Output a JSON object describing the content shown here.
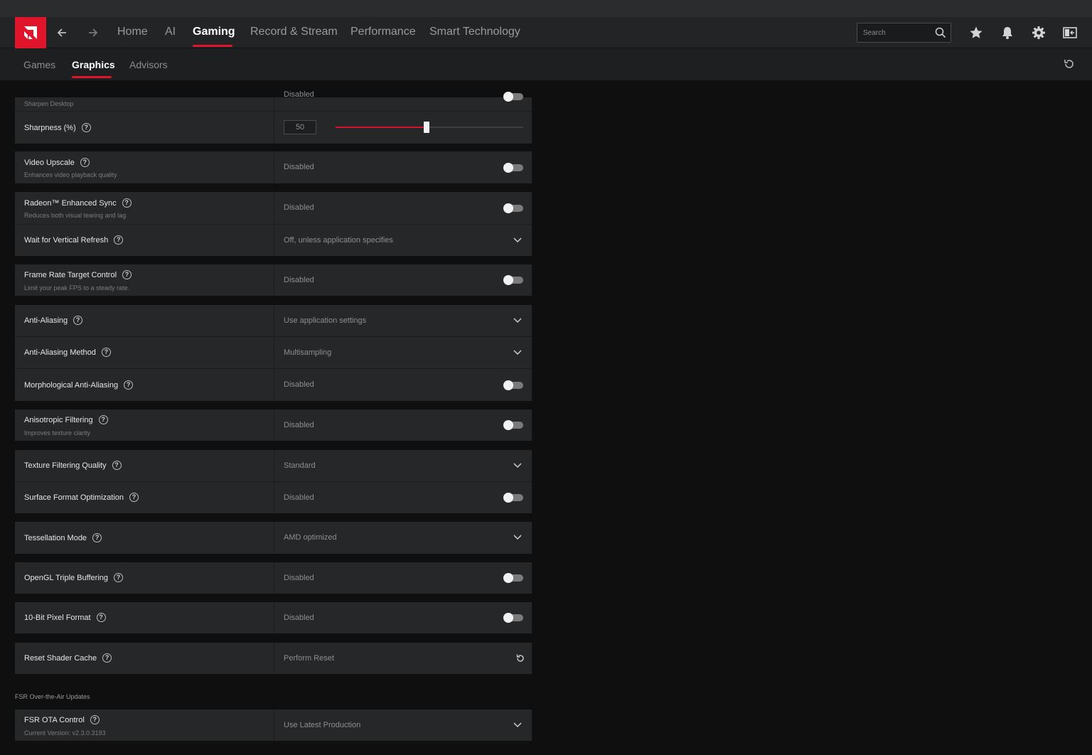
{
  "nav": {
    "tabs": [
      {
        "label": "Home"
      },
      {
        "label": "AI"
      },
      {
        "label": "Gaming"
      },
      {
        "label": "Record & Stream"
      },
      {
        "label": "Performance"
      },
      {
        "label": "Smart Technology"
      }
    ],
    "active_tab": "Gaming",
    "search_placeholder": "Search",
    "icons": [
      "back-arrow-icon",
      "forward-arrow-icon",
      "search-icon",
      "star-icon",
      "bell-icon",
      "gear-icon",
      "sidebar-panel-icon"
    ]
  },
  "subnav": {
    "tabs": [
      {
        "label": "Games"
      },
      {
        "label": "Graphics"
      },
      {
        "label": "Advisors"
      }
    ],
    "active_tab": "Graphics"
  },
  "colors": {
    "accent": "#e0152b",
    "background": "#0f0f10",
    "row": "#262729"
  },
  "settings": {
    "sharpen_desktop": {
      "label": "Sharpen Desktop",
      "value": "Disabled"
    },
    "sharpness": {
      "label": "Sharpness (%)",
      "value": "50",
      "percent": 50
    },
    "video_upscale": {
      "label": "Video Upscale",
      "sub": "Enhances video playback quality",
      "value": "Disabled"
    },
    "enhanced_sync": {
      "label": "Radeon™ Enhanced Sync",
      "sub": "Reduces both visual tearing and lag",
      "value": "Disabled"
    },
    "vertical_refresh": {
      "label": "Wait for Vertical Refresh",
      "value": "Off, unless application specifies"
    },
    "frtc": {
      "label": "Frame Rate Target Control",
      "sub": "Limit your peak FPS to a steady rate.",
      "value": "Disabled"
    },
    "anti_aliasing": {
      "label": "Anti-Aliasing",
      "value": "Use application settings"
    },
    "aa_method": {
      "label": "Anti-Aliasing Method",
      "value": "Multisampling"
    },
    "morph_aa": {
      "label": "Morphological Anti-Aliasing",
      "value": "Disabled"
    },
    "aniso": {
      "label": "Anisotropic Filtering",
      "sub": "Improves texture clarity",
      "value": "Disabled"
    },
    "texture_quality": {
      "label": "Texture Filtering Quality",
      "value": "Standard"
    },
    "surface_format": {
      "label": "Surface Format Optimization",
      "value": "Disabled"
    },
    "tessellation": {
      "label": "Tessellation Mode",
      "value": "AMD optimized"
    },
    "opengl_tb": {
      "label": "OpenGL Triple Buffering",
      "value": "Disabled"
    },
    "pixel_10bit": {
      "label": "10-Bit Pixel Format",
      "value": "Disabled"
    },
    "shader_cache": {
      "label": "Reset Shader Cache",
      "value": "Perform Reset"
    },
    "fsr_section": "FSR Over-the-Air Updates",
    "fsr_ota": {
      "label": "FSR OTA Control",
      "sub": "Current Version: v2.3.0.3193",
      "value": "Use Latest Production"
    }
  }
}
